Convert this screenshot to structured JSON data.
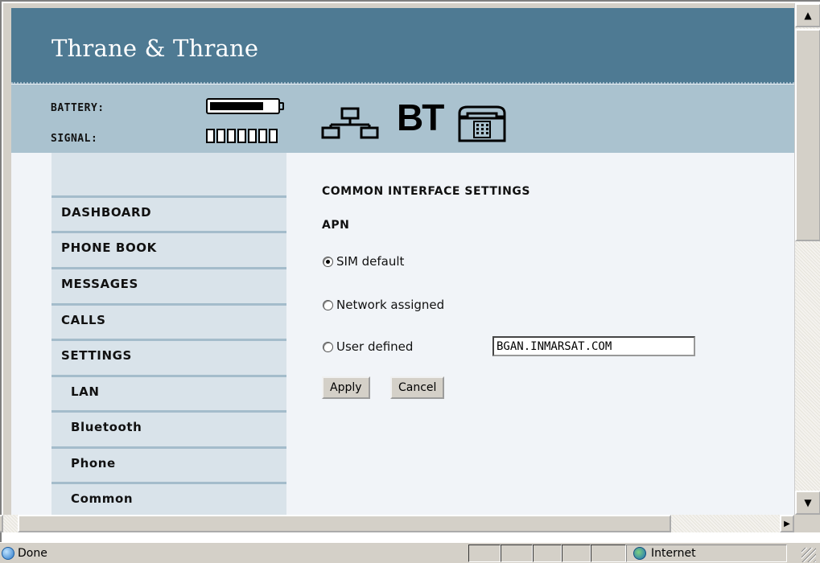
{
  "brand": {
    "logo_text": "Thrane & Thrane"
  },
  "status": {
    "battery_label": "BATTERY:",
    "signal_label": "SIGNAL:",
    "battery_level": 0.8,
    "signal_bars_total": 7,
    "signal_bars_active": 0,
    "icons": [
      "lan-icon",
      "bluetooth-icon",
      "phone-icon"
    ],
    "bluetooth_text": "BT"
  },
  "nav": {
    "items": [
      {
        "label": "DASHBOARD"
      },
      {
        "label": "PHONE BOOK"
      },
      {
        "label": "MESSAGES"
      },
      {
        "label": "CALLS"
      },
      {
        "label": "SETTINGS"
      },
      {
        "label": "LAN"
      },
      {
        "label": "Bluetooth"
      },
      {
        "label": "Phone"
      },
      {
        "label": "Common"
      }
    ]
  },
  "content": {
    "section_title": "COMMON INTERFACE SETTINGS",
    "apn_title": "APN",
    "options": [
      {
        "label": "SIM default",
        "checked": true
      },
      {
        "label": "Network assigned",
        "checked": false
      },
      {
        "label": "User defined",
        "checked": false
      }
    ],
    "user_defined_value": "BGAN.INMARSAT.COM",
    "apply_label": "Apply",
    "cancel_label": "Cancel"
  },
  "browser_status": {
    "left_text": "Done",
    "zone_text": "Internet"
  },
  "colors": {
    "banner": "#4e7a93",
    "status_strip": "#aac2cf",
    "nav_bg": "#d9e3ea",
    "content_bg": "#f1f4f8"
  }
}
